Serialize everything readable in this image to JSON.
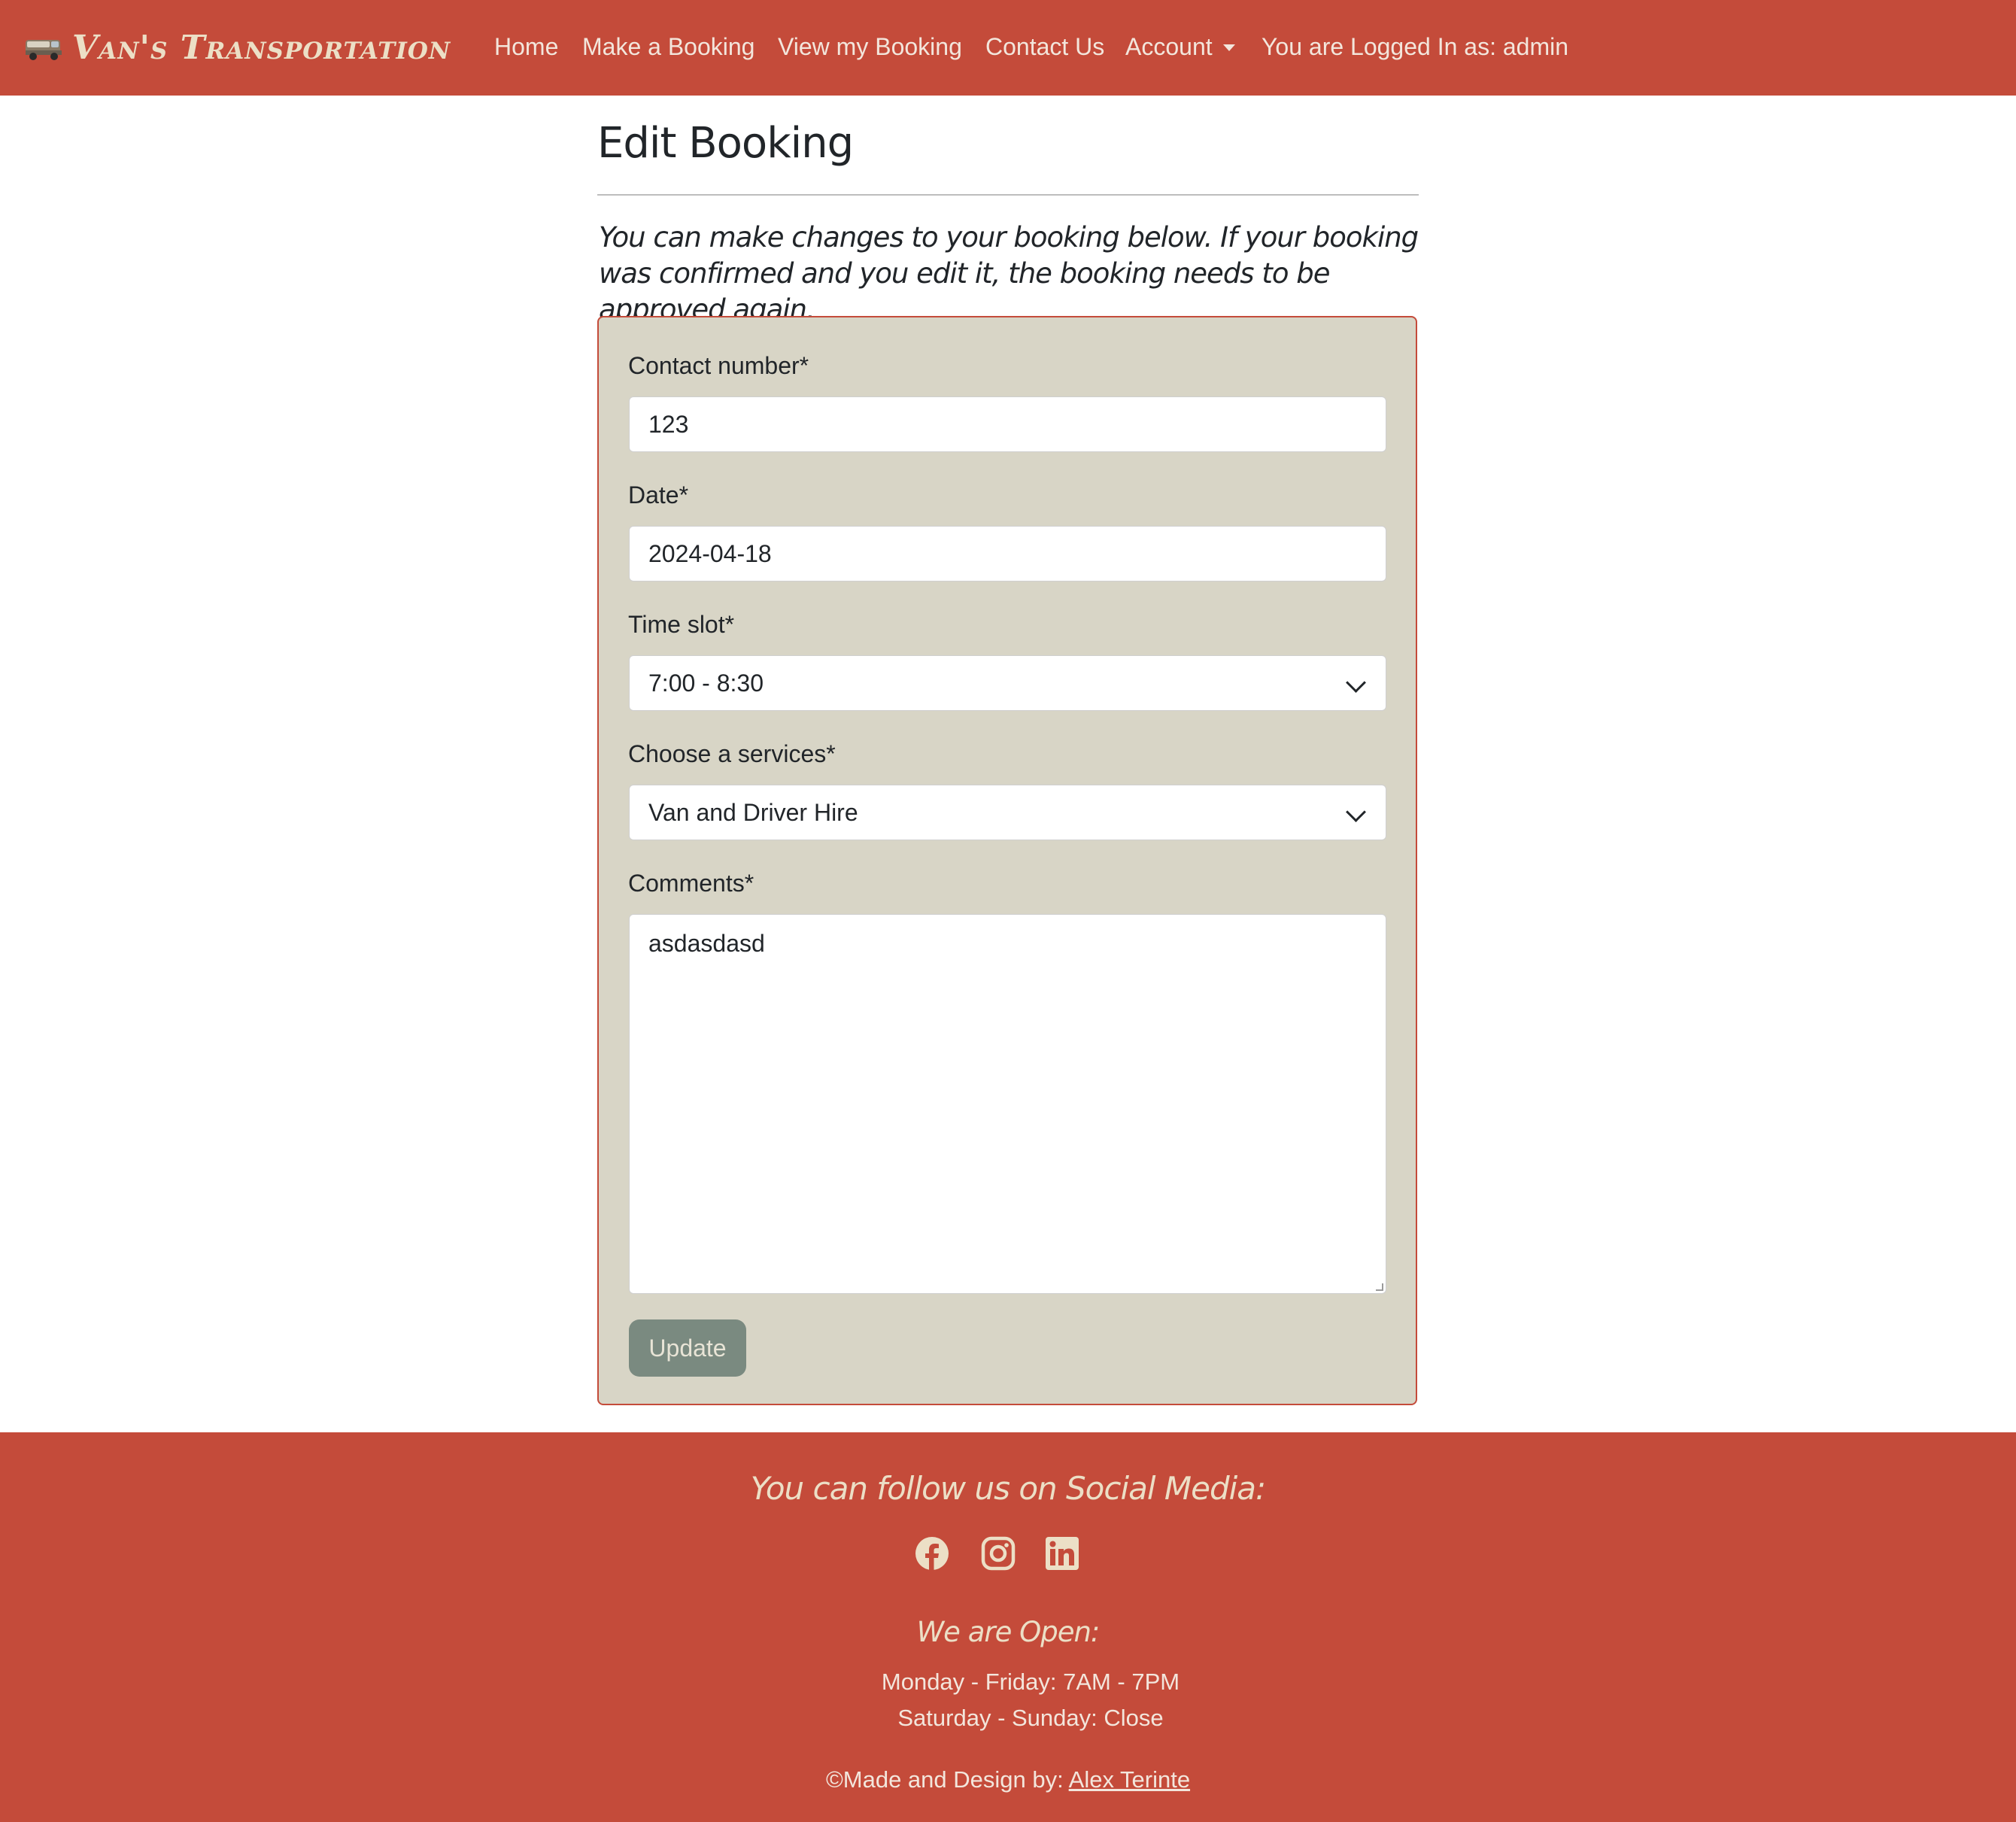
{
  "navbar": {
    "brand": "Van's Transportation",
    "logo_icon": "van-icon",
    "links": {
      "home": "Home",
      "make_booking": "Make a Booking",
      "view_booking": "View my Booking",
      "contact": "Contact Us",
      "account": "Account"
    },
    "logged_in": "You are Logged In as: admin"
  },
  "main": {
    "title": "Edit Booking",
    "intro": "You can make changes to your booking below. If your booking was confirmed and you edit it, the booking needs to be approved again."
  },
  "form": {
    "contact_label": "Contact number*",
    "contact_value": "123",
    "date_label": "Date*",
    "date_value": "2024-04-18",
    "time_label": "Time slot*",
    "time_value": "7:00 - 8:30",
    "service_label": "Choose a services*",
    "service_value": "Van and Driver Hire",
    "comments_label": "Comments*",
    "comments_value": "asdasdasd",
    "submit_label": "Update"
  },
  "footer": {
    "follow": "You can follow us on Social Media:",
    "social_icons": [
      "facebook-icon",
      "instagram-icon",
      "linkedin-icon"
    ],
    "open_title": "We are Open:",
    "hours_weekday": "Monday - Friday: 7AM - 7PM",
    "hours_weekend": "Saturday - Sunday: Close",
    "credit_prefix": "©Made and Design by:",
    "credit_name": "Alex Terinte"
  },
  "colors": {
    "primary": "#c44b3a",
    "card_bg": "#d8d5c6",
    "button": "#7a8a80",
    "accent_text": "#ecdfc6"
  }
}
